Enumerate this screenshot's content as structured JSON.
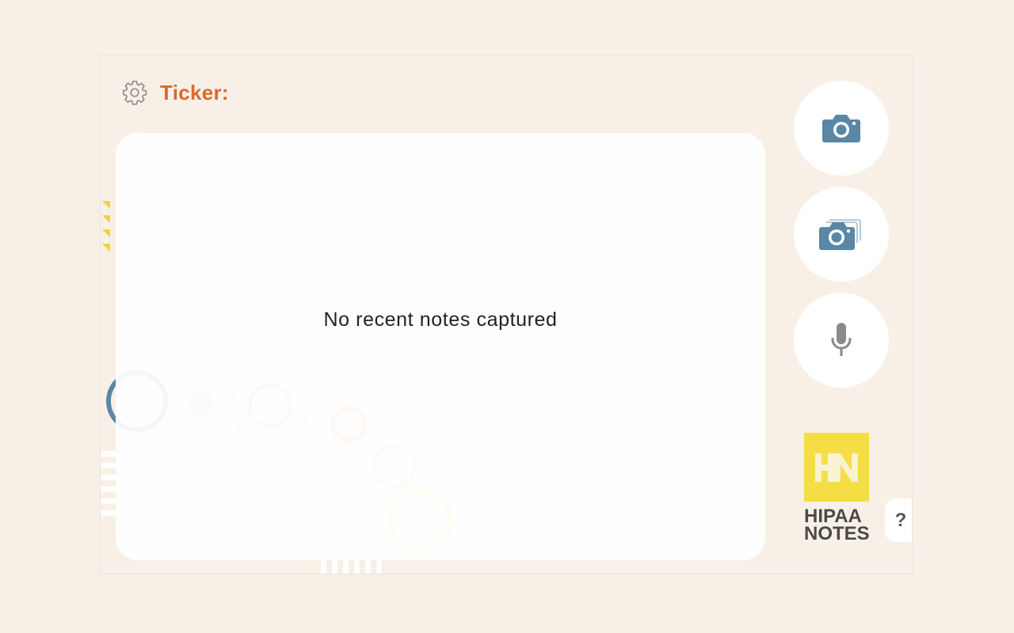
{
  "header": {
    "title": "Ticker:"
  },
  "notes": {
    "empty_message": "No recent notes captured"
  },
  "actions": {
    "photo": "camera-icon",
    "multi_photo": "multi-camera-icon",
    "voice": "microphone-icon"
  },
  "brand": {
    "logo_mark": "HN",
    "line1": "HIPAA",
    "line2": "NOTES"
  },
  "help": {
    "label": "?"
  },
  "colors": {
    "background": "#f8f0e6",
    "accent": "#d9692f",
    "camera_blue": "#5a87a6",
    "mic_gray": "#8a8a8a",
    "brand_yellow": "#f5dd45",
    "brand_text": "#4a4a4a"
  }
}
